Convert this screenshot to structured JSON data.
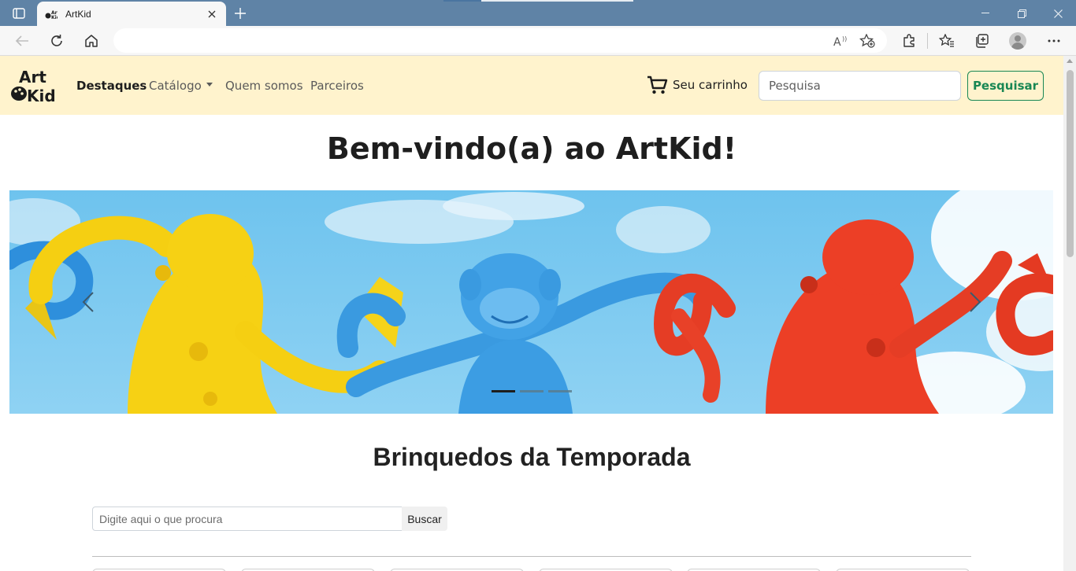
{
  "browser": {
    "tab_title": "ArtKid",
    "address_text": "",
    "colors": {
      "titlebar": "#5f83a6",
      "toolbar": "#f7f7f7"
    }
  },
  "site": {
    "logo_top": "Art",
    "logo_bottom": "Kid",
    "nav": {
      "items": [
        {
          "label": "Destaques",
          "active": true
        },
        {
          "label": "Catálogo",
          "dropdown": true
        },
        {
          "label": "Quem somos"
        },
        {
          "label": "Parceiros"
        }
      ],
      "cart_label": "Seu carrinho",
      "search_placeholder": "Pesquisa",
      "search_button": "Pesquisar"
    },
    "welcome_title": "Bem-vindo(a) ao ArtKid!",
    "carousel": {
      "slides": 3,
      "active_slide": 1,
      "image": "colorful plastic monkeys linked by arms against blue sky"
    },
    "section_title": "Brinquedos da Temporada",
    "filter": {
      "placeholder": "Digite aqui o que procura",
      "button": "Buscar"
    },
    "colors": {
      "navbar_bg": "#fff3cd",
      "success": "#198754"
    }
  }
}
